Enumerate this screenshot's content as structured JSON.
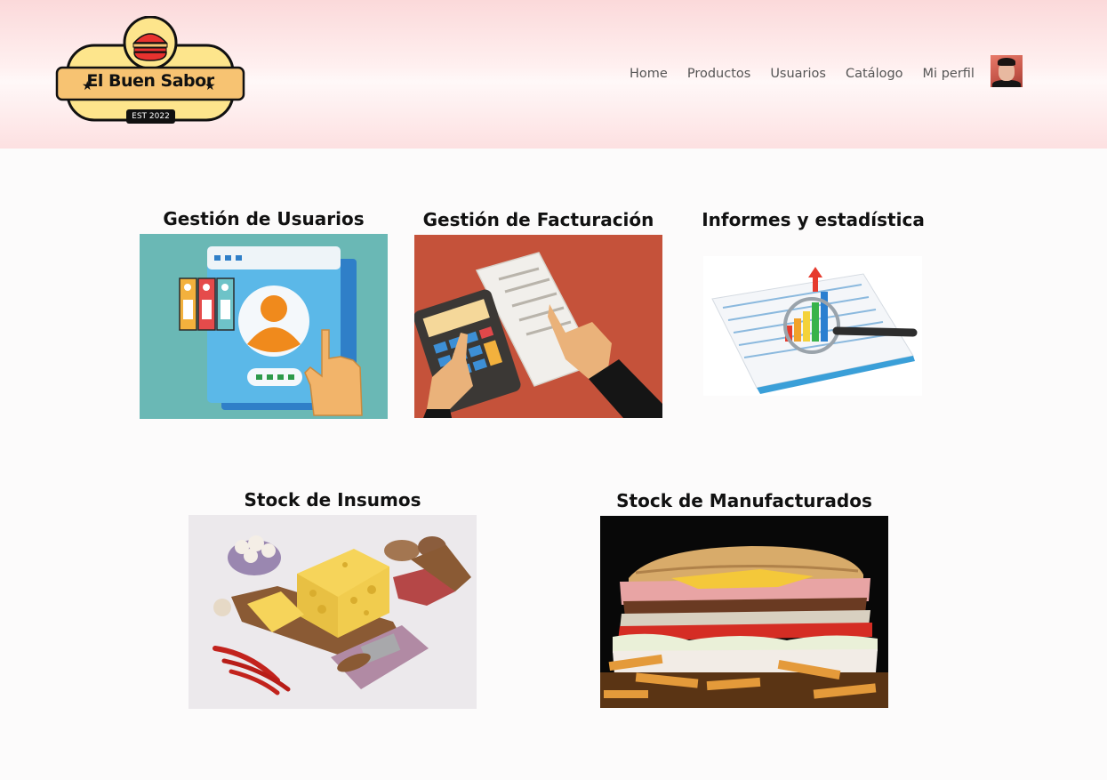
{
  "brand": {
    "name": "El Buen Sabor",
    "est": "EST 2022"
  },
  "nav": {
    "items": [
      "Home",
      "Productos",
      "Usuarios",
      "Catálogo",
      "Mi perfil"
    ]
  },
  "cards": [
    {
      "title": "Gestión de Usuarios"
    },
    {
      "title": "Gestión de Facturación"
    },
    {
      "title": "Informes y estadística"
    },
    {
      "title": "Stock de Insumos"
    },
    {
      "title": "Stock de Manufacturados"
    }
  ],
  "colors": {
    "header_pink": "#fbd9da",
    "logo_yellow": "#fde58c",
    "logo_orange": "#f7c372",
    "burger_red": "#e8322f"
  }
}
